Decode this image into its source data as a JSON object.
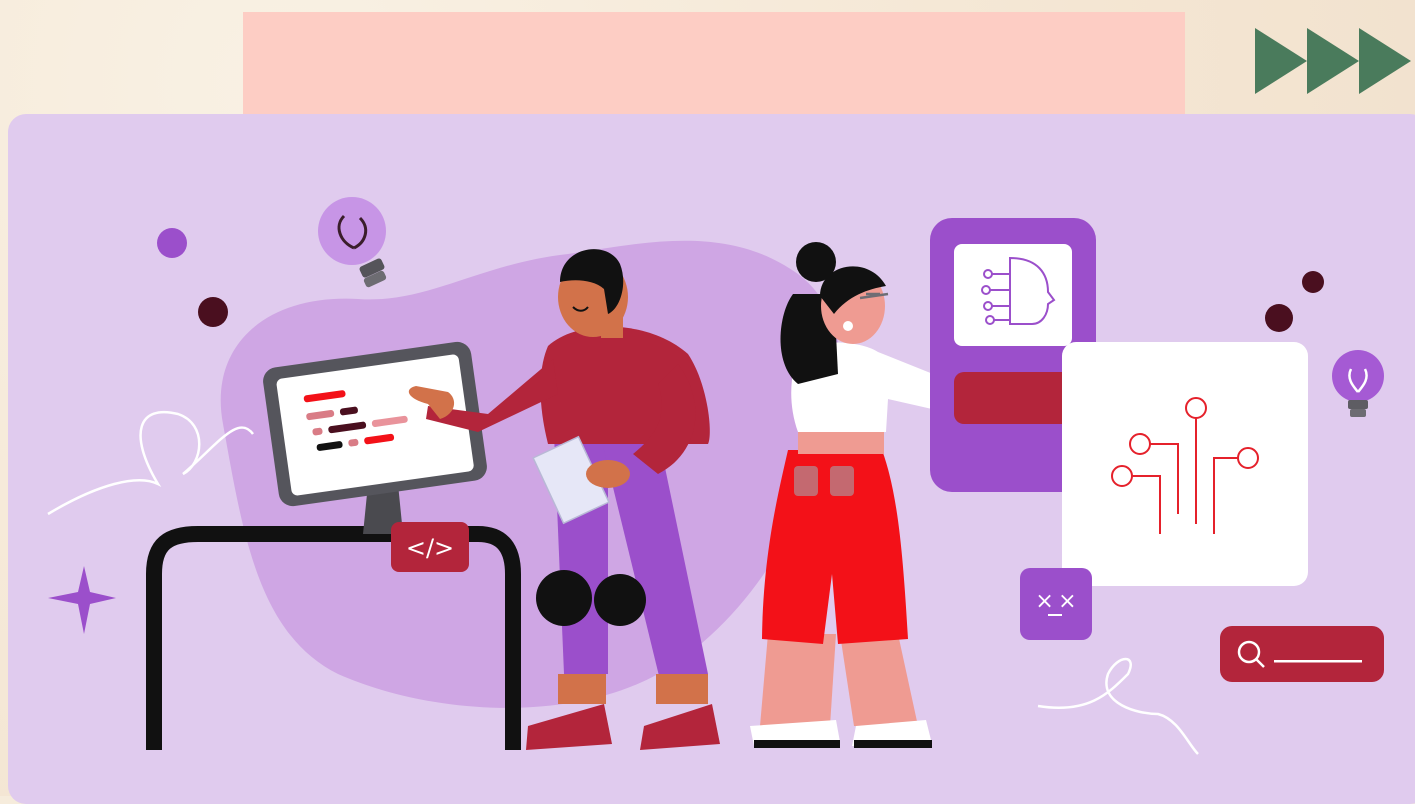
{
  "colors": {
    "page_background": "#f6ecdc",
    "title_bar": "#fdcdc4",
    "arrows": "#4a7b5c",
    "card": "#e0cbee",
    "blob": "#cfa6e4",
    "purple": "#9b4fcb",
    "crimson": "#b3253b",
    "dark_maroon": "#4a0f1f",
    "red": "#f31118"
  },
  "icons": [
    "fast-forward-arrows-icon",
    "lightbulb-icon",
    "code-tag-icon",
    "ai-face-circuit-icon",
    "circuit-icon",
    "dizzy-face-icon",
    "search-icon",
    "sparkle-star-icon"
  ],
  "code_badge_text": "</>",
  "dizzy_face_text": "× ×"
}
